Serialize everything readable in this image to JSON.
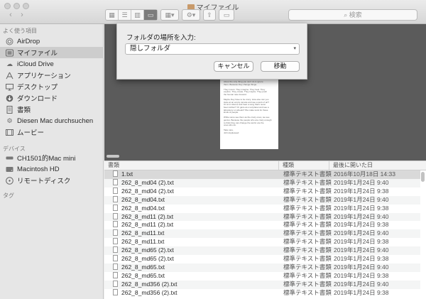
{
  "window": {
    "title": "マイファイル"
  },
  "toolbar": {
    "back_icon": "chevron-left",
    "forward_icon": "chevron-right",
    "view_icons": [
      "icon-view",
      "list-view",
      "column-view",
      "coverflow-view"
    ],
    "search_placeholder": "検索"
  },
  "sidebar": {
    "favorites_heading": "よく使う項目",
    "favorites": [
      {
        "label": "AirDrop",
        "icon": "airdrop-icon"
      },
      {
        "label": "マイファイル",
        "icon": "all-files-icon",
        "selected": true
      },
      {
        "label": "iCloud Drive",
        "icon": "cloud-icon"
      },
      {
        "label": "アプリケーション",
        "icon": "applications-icon"
      },
      {
        "label": "デスクトップ",
        "icon": "desktop-icon"
      },
      {
        "label": "ダウンロード",
        "icon": "download-icon"
      },
      {
        "label": "書類",
        "icon": "documents-icon"
      },
      {
        "label": "Diesen Mac durchsuchen",
        "icon": "gear-icon"
      },
      {
        "label": "ムービー",
        "icon": "movie-icon"
      }
    ],
    "devices_heading": "デバイス",
    "devices": [
      {
        "label": "CH1501的Mac mini",
        "icon": "computer-icon"
      },
      {
        "label": "Macintosh HD",
        "icon": "disk-icon"
      },
      {
        "label": "リモートディスク",
        "icon": "remote-disc-icon"
      }
    ],
    "tags_heading": "タグ"
  },
  "dialog": {
    "label": "フォルダの場所を入力:",
    "input_value": "隠しフォルダ",
    "cancel_label": "キャンセル",
    "move_label": "移動"
  },
  "preview": {
    "caption": "1.txt",
    "text_lines": [
      "About the only thing you can't do is ignore",
      "them. Because they change things.",
      "",
      "They invent. They imagine. They heal. They",
      "explore. They create. They inspire. They push",
      "the human race forward.",
      "",
      "Maybe they have to be crazy. How else can you",
      "stare at an empty canvas and see a work of art?",
      "Or sit in silence and hear a song that's never",
      "been written? Or gaze at a red planet and see a",
      "laboratory on wheels? We make tools for these",
      "kinds of people.",
      "",
      "While some see them as the crazy ones, we see",
      "genius. Because the people who are crazy enough",
      "to think they can change the world, are the",
      "ones who do.",
      "",
      "Take care,",
      "John Appleseed"
    ]
  },
  "file_list": {
    "columns": [
      "書類",
      "種類",
      "最後に開いた日"
    ],
    "rows": [
      {
        "name": "1.txt",
        "kind": "標準テキスト書類",
        "date": "2016年10月18日 14:33",
        "selected": true
      },
      {
        "name": "262_8_md04 (2).txt",
        "kind": "標準テキスト書類",
        "date": "2019年1月24日 9:40"
      },
      {
        "name": "262_8_md04 (2).txt",
        "kind": "標準テキスト書類",
        "date": "2019年1月24日 9:38"
      },
      {
        "name": "262_8_md04.txt",
        "kind": "標準テキスト書類",
        "date": "2019年1月24日 9:40"
      },
      {
        "name": "262_8_md04.txt",
        "kind": "標準テキスト書類",
        "date": "2019年1月24日 9:38"
      },
      {
        "name": "262_8_md11 (2).txt",
        "kind": "標準テキスト書類",
        "date": "2019年1月24日 9:40"
      },
      {
        "name": "262_8_md11 (2).txt",
        "kind": "標準テキスト書類",
        "date": "2019年1月24日 9:38"
      },
      {
        "name": "262_8_md11.txt",
        "kind": "標準テキスト書類",
        "date": "2019年1月24日 9:40"
      },
      {
        "name": "262_8_md11.txt",
        "kind": "標準テキスト書類",
        "date": "2019年1月24日 9:38"
      },
      {
        "name": "262_8_md65 (2).txt",
        "kind": "標準テキスト書類",
        "date": "2019年1月24日 9:40"
      },
      {
        "name": "262_8_md65 (2).txt",
        "kind": "標準テキスト書類",
        "date": "2019年1月24日 9:38"
      },
      {
        "name": "262_8_md65.txt",
        "kind": "標準テキスト書類",
        "date": "2019年1月24日 9:40"
      },
      {
        "name": "262_8_md65.txt",
        "kind": "標準テキスト書類",
        "date": "2019年1月24日 9:38"
      },
      {
        "name": "262_8_md356 (2).txt",
        "kind": "標準テキスト書類",
        "date": "2019年1月24日 9:40"
      },
      {
        "name": "262_8_md356 (2).txt",
        "kind": "標準テキスト書類",
        "date": "2019年1月24日 9:38"
      }
    ]
  }
}
